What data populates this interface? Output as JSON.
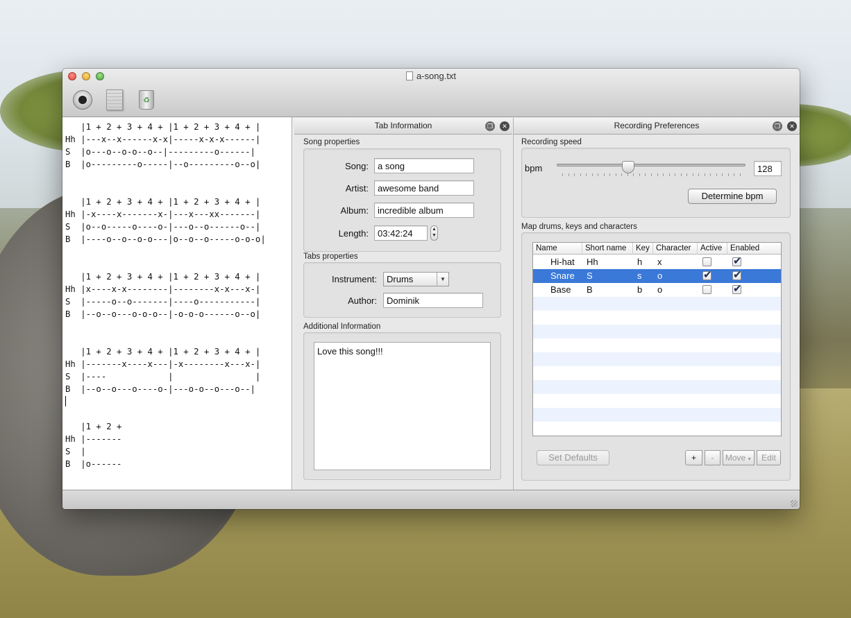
{
  "window": {
    "title": "a-song.txt"
  },
  "toolbar": {
    "record_icon": "record-icon",
    "document_icon": "document-icon",
    "trash_icon": "trash-icon"
  },
  "editor": {
    "lines": [
      "   |1 + 2 + 3 + 4 + |1 + 2 + 3 + 4 + |",
      "Hh |---x--x------x-x|-----x-x-x------|",
      "S  |o---o--o-o--o--|---------o------|",
      "B  |o---------o-----|--o---------o--o|",
      "",
      "",
      "   |1 + 2 + 3 + 4 + |1 + 2 + 3 + 4 + |",
      "Hh |-x----x-------x-|---x---xx-------|",
      "S  |o--o-----o----o-|---o--o------o--|",
      "B  |----o--o--o-o---|o--o--o-----o-o-o|",
      "",
      "",
      "   |1 + 2 + 3 + 4 + |1 + 2 + 3 + 4 + |",
      "Hh |x----x-x--------|--------x-x---x-|",
      "S  |-----o--o-------|----o-----------|",
      "B  |--o--o---o-o-o--|-o-o-o------o--o|",
      "",
      "",
      "   |1 + 2 + 3 + 4 + |1 + 2 + 3 + 4 + |",
      "Hh |-------x----x---|-x--------x---x-|",
      "S  |----            |                |",
      "B  |--o--o---o----o-|---o-o--o---o--|",
      "",
      "",
      "   |1 + 2 +",
      "Hh |-------",
      "S  |",
      "B  |o------"
    ]
  },
  "tab_info": {
    "header": "Tab Information",
    "song_group": "Song properties",
    "song_label": "Song:",
    "song_value": "a song",
    "artist_label": "Artist:",
    "artist_value": "awesome band",
    "album_label": "Album:",
    "album_value": "incredible album",
    "length_label": "Length:",
    "length_value": "03:42:24",
    "tabs_group": "Tabs properties",
    "instrument_label": "Instrument:",
    "instrument_value": "Drums",
    "author_label": "Author:",
    "author_value": "Dominik",
    "additional_group": "Additional Information",
    "additional_text": "Love this song!!!"
  },
  "rec_prefs": {
    "header": "Recording Preferences",
    "speed_group": "Recording speed",
    "bpm_label": "bpm",
    "bpm_value": "128",
    "bpm_slider_fraction": 0.38,
    "determine_button": "Determine bpm",
    "map_group": "Map drums, keys and characters",
    "columns": [
      "Name",
      "Short name",
      "Key",
      "Character",
      "Active",
      "Enabled"
    ],
    "rows": [
      {
        "name": "Hi-hat",
        "short": "Hh",
        "key": "h",
        "char": "x",
        "active": false,
        "enabled": true,
        "selected": false
      },
      {
        "name": "Snare",
        "short": "S",
        "key": "s",
        "char": "o",
        "active": true,
        "enabled": true,
        "selected": true
      },
      {
        "name": "Base",
        "short": "B",
        "key": "b",
        "char": "o",
        "active": false,
        "enabled": true,
        "selected": false
      }
    ],
    "set_defaults": "Set Defaults",
    "add": "+",
    "remove": "-",
    "move": "Move",
    "edit": "Edit"
  },
  "colors": {
    "selection": "#3a79d8",
    "alt_row": "#edf3fe"
  }
}
